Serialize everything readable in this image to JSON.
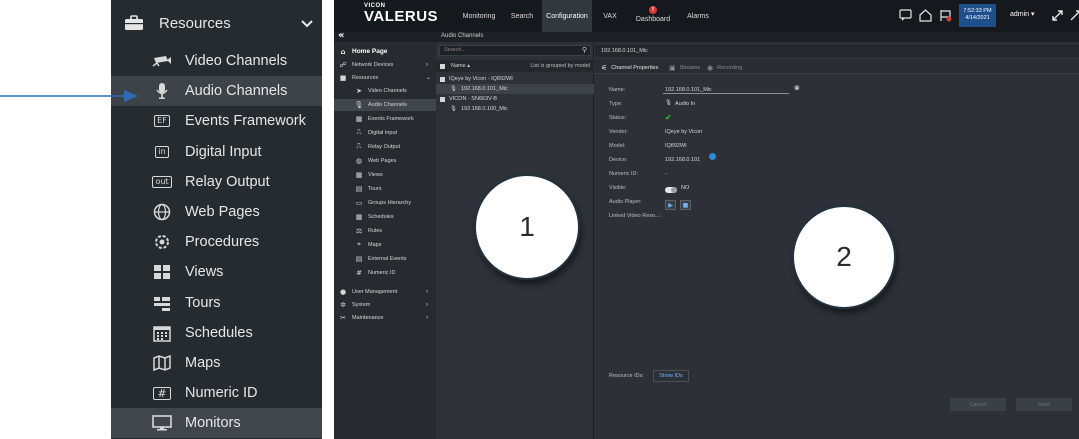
{
  "zoom_sidebar": {
    "header": "Resources",
    "items": [
      {
        "label": "Video Channels",
        "icon": "video-channels-icon"
      },
      {
        "label": "Audio Channels",
        "icon": "microphone-icon"
      },
      {
        "label": "Events Framework",
        "icon": "events-framework-icon"
      },
      {
        "label": "Digital Input",
        "icon": "digital-input-icon"
      },
      {
        "label": "Relay Output",
        "icon": "relay-output-icon"
      },
      {
        "label": "Web Pages",
        "icon": "web-pages-icon"
      },
      {
        "label": "Procedures",
        "icon": "procedures-icon"
      },
      {
        "label": "Views",
        "icon": "views-icon"
      },
      {
        "label": "Tours",
        "icon": "tours-icon"
      },
      {
        "label": "Schedules",
        "icon": "schedules-icon"
      },
      {
        "label": "Maps",
        "icon": "map-icon"
      },
      {
        "label": "Numeric ID",
        "icon": "numeric-id-icon"
      },
      {
        "label": "Monitors",
        "icon": "monitor-icon"
      }
    ],
    "icon_glyphs": {
      "ef": "EF",
      "in": "in",
      "out": "out",
      "num": "#"
    }
  },
  "app": {
    "brand": "VICON",
    "product": "VALERUS",
    "nav": [
      "Monitoring",
      "Search",
      "Configuration",
      "VAX",
      "Dashboard",
      "Alarms"
    ],
    "alert_count": "!",
    "time": "7:52:33 PM",
    "date": "4/14/2021",
    "user": "admin",
    "breadcrumb": "Audio Channels",
    "sidebar": {
      "home": "Home Page",
      "network_devices": "Network Devices",
      "resources": "Resources",
      "resource_items": [
        "Video Channels",
        "Audio Channels",
        "Events Framework",
        "Digital Input",
        "Relay Output",
        "Web Pages",
        "Views",
        "Tours",
        "Groups Hierarchy",
        "Schedules",
        "Rules",
        "Maps",
        "External Events",
        "Numeric ID"
      ],
      "user_management": "User Management",
      "system": "System",
      "maintenance": "Maintenance"
    },
    "tree": {
      "search_placeholder": "Search...",
      "column": "Name",
      "grouped_by": "List is grouped by model",
      "groups": [
        {
          "name": "IQeye by Vicon - IQ892WI",
          "items": [
            "192.168.0.101_Mic"
          ]
        },
        {
          "name": "VICON - SN663V-B",
          "items": [
            "192.168.0.100_Mic"
          ]
        }
      ]
    },
    "properties": {
      "title": "192.168.0.101_Mic",
      "tabs": [
        "Channel Properties",
        "Streams",
        "Recording"
      ],
      "fields": [
        {
          "label": "Name:",
          "value": "192.168.0.101_Mic"
        },
        {
          "label": "Type:",
          "value": "Audio In"
        },
        {
          "label": "Status:",
          "value": "✔"
        },
        {
          "label": "Vendor:",
          "value": "IQeye by Vicon"
        },
        {
          "label": "Model:",
          "value": "IQ892WI"
        },
        {
          "label": "Device:",
          "value": "192.168.0.101"
        },
        {
          "label": "Numeric ID:",
          "value": "-"
        },
        {
          "label": "Visible:",
          "value": "NO"
        },
        {
          "label": "Audio Player:",
          "value": ""
        },
        {
          "label": "Linked Video Reso...:",
          "value": ""
        }
      ],
      "resource_ids_label": "Resource IDs:",
      "show_ids": "Show IDs",
      "cancel": "Cancel",
      "save": "Save",
      "visible_on": false
    }
  },
  "callouts": [
    "1",
    "2"
  ],
  "colors": {
    "accent_blue": "#2f8ad8",
    "arrow_blue": "#2e6db4",
    "status_green": "#3fbf3f",
    "alert_red": "#d63a32"
  }
}
